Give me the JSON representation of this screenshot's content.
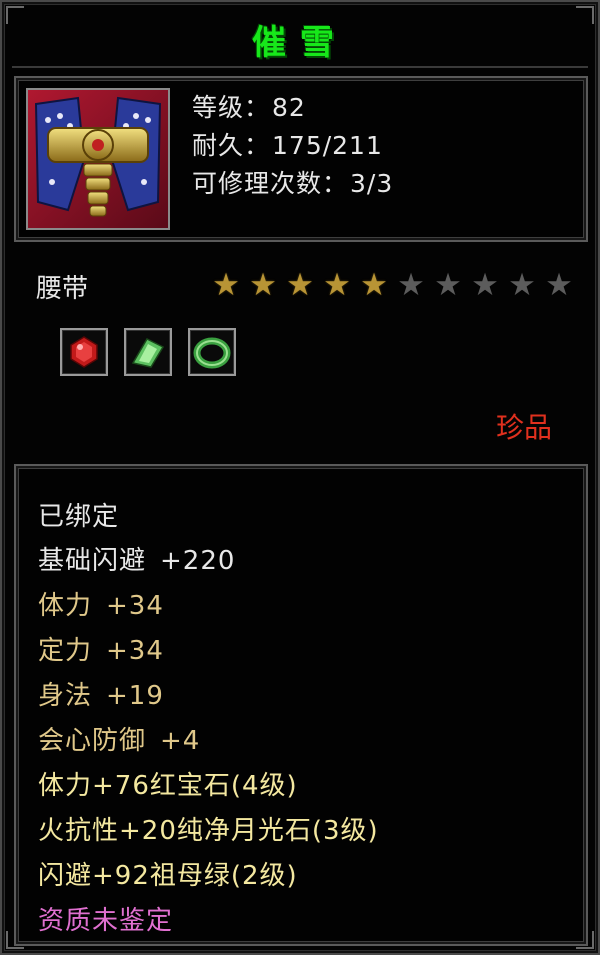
{
  "title": "催雪",
  "header": {
    "level_label": "等级：",
    "level_value": "82",
    "durability_label": "耐久：",
    "durability_value": "175/211",
    "repair_label": "可修理次数：",
    "repair_value": "3/3"
  },
  "item_type": "腰带",
  "stars": {
    "filled": 5,
    "total": 10,
    "on_color": "#b89435",
    "off_color": "#5c5c5c"
  },
  "gems": [
    {
      "name": "red-ruby-icon",
      "color": "#d42020"
    },
    {
      "name": "green-crystal-icon",
      "color": "#5cc060"
    },
    {
      "name": "green-ring-icon",
      "color": "#40a848"
    }
  ],
  "rarity": "珍品",
  "stats": {
    "bound": "已绑定",
    "base_dodge": {
      "label": "基础闪避",
      "value": "+220"
    },
    "stamina": {
      "label": "体力",
      "value": "+34"
    },
    "focus": {
      "label": "定力",
      "value": "+34"
    },
    "agility": {
      "label": "身法",
      "value": "+19"
    },
    "crit_def": {
      "label": "会心防御",
      "value": "+4"
    },
    "gem1": "体力+76红宝石(4级)",
    "gem2": "火抗性+20纯净月光石(3级)",
    "gem3": "闪避+92祖母绿(2级)",
    "quality": "资质未鉴定"
  },
  "colors": {
    "title": "#17e81a",
    "white_text": "#e8e8e8",
    "gold_text": "#e0c88a",
    "gem_text": "#f4e8a0",
    "quality_text": "#e070d0",
    "rarity": "#e0301e"
  }
}
